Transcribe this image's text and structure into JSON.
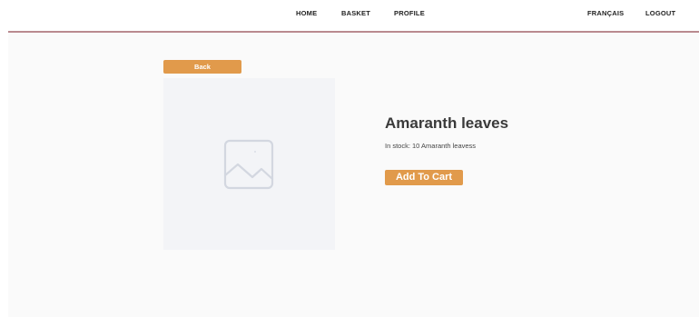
{
  "nav": {
    "home": "HOME",
    "basket": "BASKET",
    "profile": "PROFILE",
    "language": "FRANÇAIS",
    "logout": "LOGOUT"
  },
  "page": {
    "back_label": "Back",
    "product_name": "Amaranth leaves",
    "stock_text": "In stock: 10 Amaranth leavess",
    "add_to_cart_label": "Add To Cart"
  },
  "colors": {
    "accent": "#e19a4b",
    "divider": "#b98a8f",
    "content_background": "#fafafa",
    "image_placeholder_background": "#f3f4f7"
  },
  "icons": {
    "product_image": "image-placeholder-icon"
  }
}
